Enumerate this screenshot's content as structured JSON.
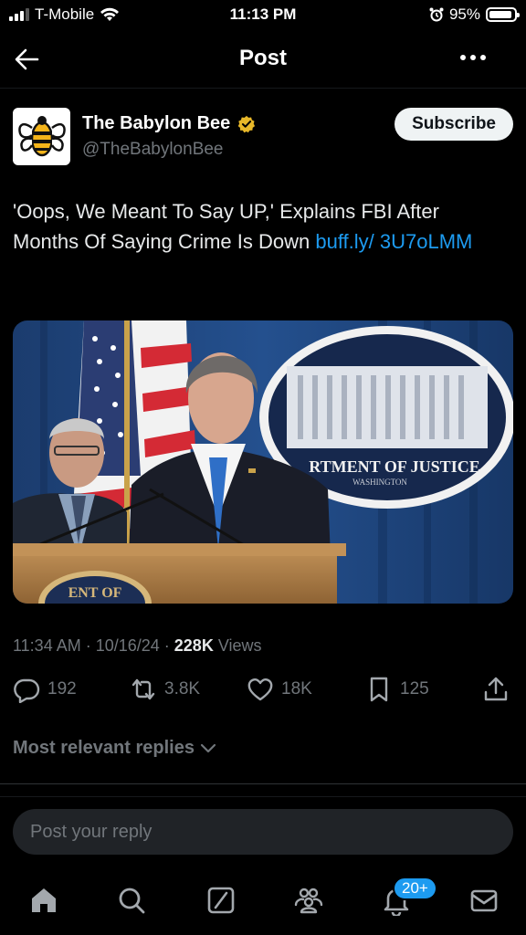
{
  "status_bar": {
    "carrier": "T-Mobile",
    "time": "11:13 PM",
    "battery": "95%",
    "icons": [
      "signal-icon",
      "wifi-icon",
      "alarm-icon",
      "battery-icon"
    ]
  },
  "header": {
    "title": "Post",
    "back_icon": "arrow-left-icon",
    "more_icon": "more-dots-icon"
  },
  "author": {
    "name": "The Babylon Bee",
    "handle": "@TheBabylonBee",
    "verified_badge": "verified-gold-icon",
    "subscribe_label": "Subscribe"
  },
  "tweet": {
    "text": "'Oops, We Meant To Say UP,' Explains FBI After Months Of Saying Crime Is Down ",
    "link_text": "buff.ly/ 3U7oLMM",
    "image": {
      "seal_text": "RTMENT OF JUSTICE",
      "seal_subtext": "WASHINGTON",
      "podium_text": "ENT OF"
    },
    "timestamp": "11:34 AM · 10/16/24 · ",
    "views_count": "228K",
    "views_label": " Views"
  },
  "actions": {
    "replies": "192",
    "reposts": "3.8K",
    "likes": "18K",
    "bookmarks": "125"
  },
  "replies_sort": {
    "label": "Most relevant replies",
    "icon": "chevron-down-icon"
  },
  "reply_input": {
    "placeholder": "Post your reply"
  },
  "bottom_nav": {
    "items": [
      "home-icon",
      "search-icon",
      "grok-icon",
      "communities-icon",
      "notifications-icon",
      "messages-icon"
    ],
    "notification_badge": "20+"
  },
  "colors": {
    "background": "#000000",
    "link": "#1d9bf0",
    "muted": "#71767b",
    "text": "#e7e9ea",
    "verified": "#e8b829"
  }
}
